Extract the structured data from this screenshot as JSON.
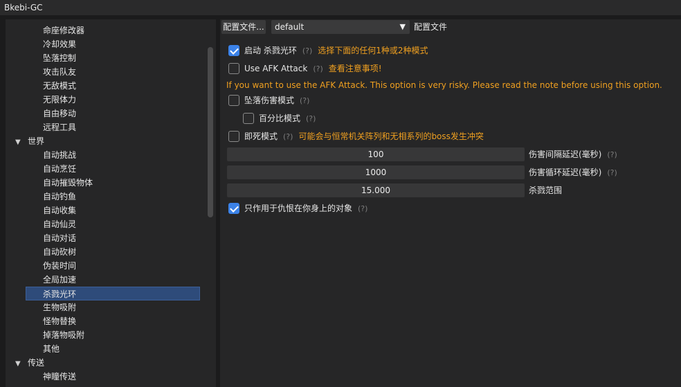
{
  "window": {
    "title": "Bkebi-GC"
  },
  "sidebar": {
    "rows": [
      {
        "type": "item",
        "label": "命座修改器"
      },
      {
        "type": "item",
        "label": "冷却效果"
      },
      {
        "type": "item",
        "label": "坠落控制"
      },
      {
        "type": "item",
        "label": "攻击队友"
      },
      {
        "type": "item",
        "label": "无敌模式"
      },
      {
        "type": "item",
        "label": "无限体力"
      },
      {
        "type": "item",
        "label": "自由移动"
      },
      {
        "type": "item",
        "label": "远程工具"
      },
      {
        "type": "group",
        "label": "世界",
        "arrow": "▼"
      },
      {
        "type": "item",
        "label": "自动挑战"
      },
      {
        "type": "item",
        "label": "自动烹饪"
      },
      {
        "type": "item",
        "label": "自动摧毁物体"
      },
      {
        "type": "item",
        "label": "自动钓鱼"
      },
      {
        "type": "item",
        "label": "自动收集"
      },
      {
        "type": "item",
        "label": "自动仙灵"
      },
      {
        "type": "item",
        "label": "自动对话"
      },
      {
        "type": "item",
        "label": "自动砍树"
      },
      {
        "type": "item",
        "label": "伪装时间"
      },
      {
        "type": "item",
        "label": "全局加速"
      },
      {
        "type": "item",
        "label": "杀戮光环",
        "selected": true
      },
      {
        "type": "item",
        "label": "生物吸附"
      },
      {
        "type": "item",
        "label": "怪物替换"
      },
      {
        "type": "item",
        "label": "掉落物吸附"
      },
      {
        "type": "item",
        "label": "其他"
      },
      {
        "type": "group",
        "label": "传送",
        "arrow": "▼"
      },
      {
        "type": "item",
        "label": "神瞳传送"
      }
    ]
  },
  "profile": {
    "button_label": "配置文件...",
    "selected": "default",
    "caret": "▼",
    "label": "配置文件"
  },
  "settings": {
    "help": "(?)",
    "enable": {
      "label": "启动 杀戮光环",
      "checked": true,
      "hint": "选择下面的任何1种或2种模式"
    },
    "afk": {
      "label": "Use AFK Attack",
      "checked": false,
      "hint": "查看注意事项!"
    },
    "afk_warning": "If you want to use the AFK Attack. This option is very risky. Please read the note before using this option.",
    "fall_damage": {
      "label": "坠落伤害模式",
      "checked": false
    },
    "percent": {
      "label": "百分比模式",
      "checked": false
    },
    "instant_kill": {
      "label": "即死模式",
      "checked": false,
      "hint": "可能会与恒常机关阵列和无相系列的boss发生冲突"
    },
    "damage_delay": {
      "value": "100",
      "label": "伤害间隔延迟(毫秒)"
    },
    "cycle_delay": {
      "value": "1000",
      "label": "伤害循环延迟(毫秒)"
    },
    "range": {
      "value": "15.000",
      "label": "杀戮范围"
    },
    "only_hostile": {
      "label": "只作用于仇恨在你身上的对象",
      "checked": true
    }
  }
}
